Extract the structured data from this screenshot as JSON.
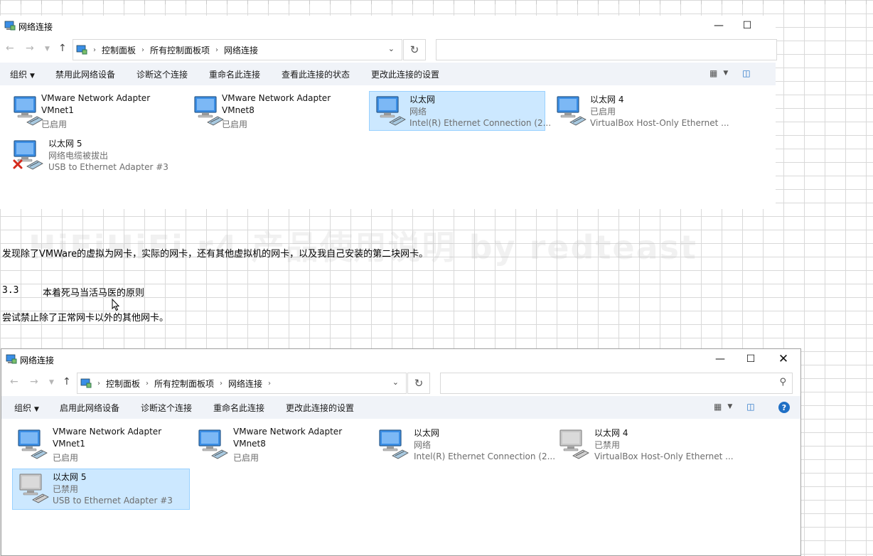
{
  "window": {
    "title": "网络连接",
    "breadcrumb": [
      "控制面板",
      "所有控制面板项",
      "网络连接"
    ],
    "refresh_icon": "↻",
    "search_icon": "search-icon"
  },
  "top_window": {
    "commands": [
      "组织",
      "禁用此网络设备",
      "诊断这个连接",
      "重命名此连接",
      "查看此连接的状态",
      "更改此连接的设置"
    ],
    "items": [
      {
        "name1": "VMware Network Adapter",
        "name2": "VMnet1",
        "status": "已启用",
        "desc": "",
        "selected": false,
        "disconnected": false,
        "disabled": false
      },
      {
        "name1": "VMware Network Adapter",
        "name2": "VMnet8",
        "status": "已启用",
        "desc": "",
        "selected": false,
        "disconnected": false,
        "disabled": false
      },
      {
        "name1": "以太网",
        "name2": "",
        "status": "网络",
        "desc": "Intel(R) Ethernet Connection (2...",
        "selected": true,
        "disconnected": false,
        "disabled": false
      },
      {
        "name1": "以太网 4",
        "name2": "",
        "status": "已启用",
        "desc": "VirtualBox Host-Only Ethernet ...",
        "selected": false,
        "disconnected": false,
        "disabled": false
      },
      {
        "name1": "以太网 5",
        "name2": "",
        "status": "网络电缆被拔出",
        "desc": "USB to Ethernet Adapter #3",
        "selected": false,
        "disconnected": true,
        "disabled": false
      }
    ]
  },
  "document": {
    "watermark": "HiFiHiFi r4 产品使用说明 by redteast",
    "para1": "发现除了VMWare的虚拟为网卡，实际的网卡，还有其他虚拟机的网卡，以及我自己安装的第二块网卡。",
    "heading_num": "3.3",
    "heading_text": "本着死马当活马医的原则",
    "para2": "尝试禁止除了正常网卡以外的其他网卡。"
  },
  "bottom_window": {
    "commands": [
      "组织",
      "启用此网络设备",
      "诊断这个连接",
      "重命名此连接",
      "更改此连接的设置"
    ],
    "items": [
      {
        "name1": "VMware Network Adapter",
        "name2": "VMnet1",
        "status": "已启用",
        "desc": "",
        "selected": false,
        "disconnected": false,
        "disabled": false
      },
      {
        "name1": "VMware Network Adapter",
        "name2": "VMnet8",
        "status": "已启用",
        "desc": "",
        "selected": false,
        "disconnected": false,
        "disabled": false
      },
      {
        "name1": "以太网",
        "name2": "",
        "status": "网络",
        "desc": "Intel(R) Ethernet Connection (2...",
        "selected": false,
        "disconnected": false,
        "disabled": false
      },
      {
        "name1": "以太网 4",
        "name2": "",
        "status": "已禁用",
        "desc": "VirtualBox Host-Only Ethernet ...",
        "selected": false,
        "disconnected": false,
        "disabled": true
      },
      {
        "name1": "以太网 5",
        "name2": "",
        "status": "已禁用",
        "desc": "USB to Ethernet Adapter #3",
        "selected": true,
        "disconnected": false,
        "disabled": true
      }
    ]
  },
  "colors": {
    "selection": "#cce8ff",
    "selection_border": "#99d1ff",
    "cmdbar": "#f0f3f8",
    "help": "#1f6fc5"
  }
}
